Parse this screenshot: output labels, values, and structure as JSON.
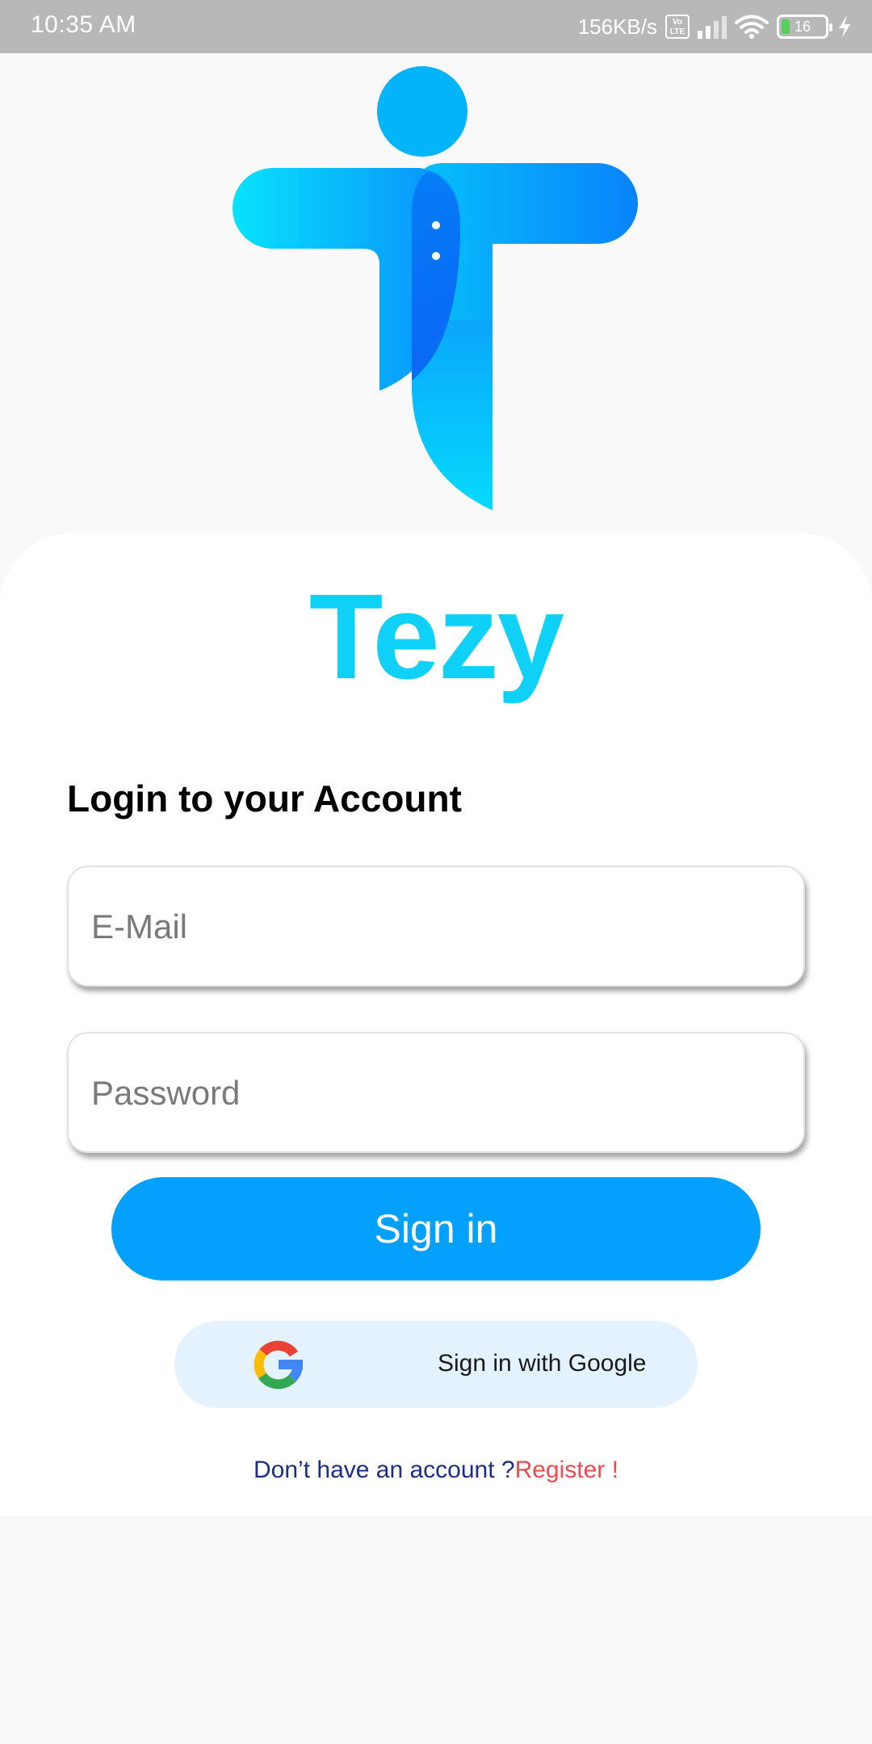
{
  "status_bar": {
    "time": "10:35 AM",
    "network_speed": "156KB/s",
    "volte": "Vo LTE",
    "battery_level": "16",
    "battery_fraction": 0.16
  },
  "app": {
    "name": "Tezy",
    "brand_color": "#0fd0f7",
    "accent_color": "#03a0fd",
    "link_color": "#f0494f"
  },
  "login": {
    "heading": "Login to your Account",
    "email": {
      "placeholder": "E-Mail",
      "value": ""
    },
    "password": {
      "placeholder": "Password",
      "value": ""
    },
    "sign_in_label": "Sign in",
    "google_label": "Sign in with Google",
    "register_prompt": "Don’t have an account ?",
    "register_link": "Register !"
  },
  "icons": {
    "logo": "tezy-logo-icon",
    "google": "google-g-icon",
    "wifi": "wifi-icon",
    "signal": "signal-icon",
    "battery": "battery-icon",
    "charging": "charging-bolt-icon"
  }
}
